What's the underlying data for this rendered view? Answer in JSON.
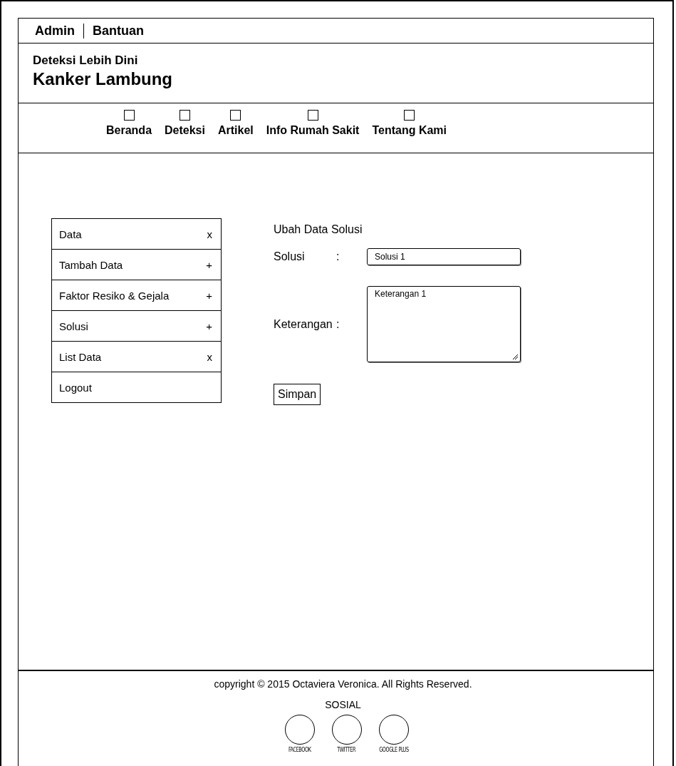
{
  "top_bar": {
    "links": [
      "Admin",
      "Bantuan"
    ]
  },
  "header": {
    "subtitle": "Deteksi Lebih Dini",
    "title": "Kanker Lambung"
  },
  "nav": {
    "items": [
      {
        "label": "Beranda"
      },
      {
        "label": "Deteksi"
      },
      {
        "label": "Artikel"
      },
      {
        "label": "Info Rumah Sakit"
      },
      {
        "label": "Tentang Kami"
      }
    ]
  },
  "sidebar": {
    "items": [
      {
        "label": "Data",
        "sign": "x"
      },
      {
        "label": "Tambah Data",
        "sign": "+"
      },
      {
        "label": "Faktor Resiko & Gejala",
        "sign": "+"
      },
      {
        "label": "Solusi",
        "sign": "+"
      },
      {
        "label": "List Data",
        "sign": "x"
      },
      {
        "label": "Logout"
      }
    ]
  },
  "form": {
    "title": "Ubah Data Solusi",
    "fields": [
      {
        "kind": "input",
        "label": "Solusi",
        "separator": ":",
        "value": "Solusi 1"
      },
      {
        "kind": "textarea",
        "label": "Keterangan",
        "separator": ":",
        "value": "Keterangan 1"
      }
    ],
    "button": "Simpan"
  },
  "footer": {
    "copyright": "copyright © 2015 Octaviera Veronica. All Rights Reserved.",
    "social_heading": "SOSIAL",
    "social": [
      "FACEBOOK",
      "TWITTER",
      "GOOGLE PLUS"
    ]
  }
}
